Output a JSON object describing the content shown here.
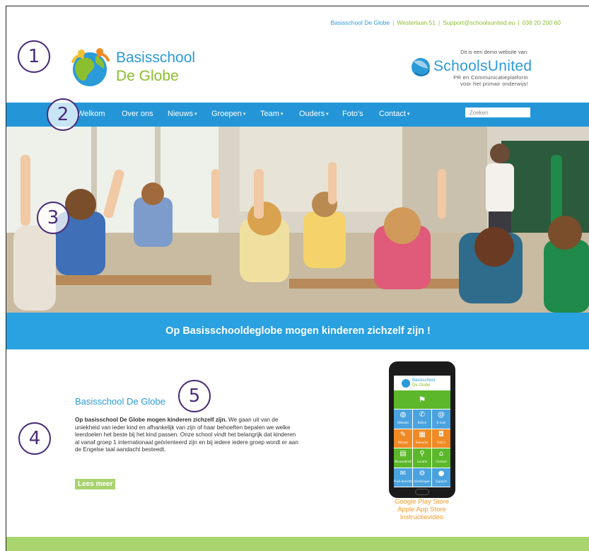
{
  "header": {
    "contact": {
      "school": "Basisschool De Globe",
      "address": "Westerlaan 51",
      "email": "Support@schoolsunited.eu",
      "phone": "038 20 200 60"
    },
    "logo": {
      "line1": "Basisschool",
      "line2": "De Globe"
    },
    "partner": {
      "note": "Dit is een demo website van:",
      "name": "SchoolsUnited",
      "tagline_1": "PR en Communicatieplatform",
      "tagline_2": "voor het primair onderwijs!"
    }
  },
  "nav": {
    "items": [
      {
        "label": "Welkom",
        "dropdown": false
      },
      {
        "label": "Over ons",
        "dropdown": false
      },
      {
        "label": "Nieuws",
        "dropdown": true
      },
      {
        "label": "Groepen",
        "dropdown": true
      },
      {
        "label": "Team",
        "dropdown": true
      },
      {
        "label": "Ouders",
        "dropdown": true
      },
      {
        "label": "Foto's",
        "dropdown": false
      },
      {
        "label": "Contact",
        "dropdown": true
      }
    ],
    "search_placeholder": "Zoeken"
  },
  "banner": {
    "text": "Op Basisschooldeglobe mogen kinderen zichzelf zijn !"
  },
  "content": {
    "heading": "Basisschool De Globe",
    "intro_bold": "Op basisschool De Globe mogen kinderen zichzelf zijn.",
    "intro_rest": " We gaan uit van de uniekheid van ieder kind en afhankelijk van zijn of haar behoeften bepalen we welke leerdoelen het beste bij het kind passen. Onze school vindt het belangrijk dat kinderen al vanaf groep 1 internationaal geörienteerd zijn en bij iedere iedere groep wordt er aan de Engelse taal aandacht besteedt.",
    "more_label": "Lees meer"
  },
  "app": {
    "screen_title_1": "Basisschool",
    "screen_title_2": "De Globe",
    "tiles": [
      {
        "label": "Website",
        "icon": "globe-icon",
        "color": "#4aa3df"
      },
      {
        "label": "Bellen",
        "icon": "phone-icon",
        "color": "#4aa3df"
      },
      {
        "label": "E-mail",
        "icon": "at-icon",
        "color": "#4aa3df"
      },
      {
        "label": "Nieuws",
        "icon": "pin-icon",
        "color": "#f08a24"
      },
      {
        "label": "Kalender",
        "icon": "calendar-icon",
        "color": "#f08a24"
      },
      {
        "label": "Foto's",
        "icon": "camera-icon",
        "color": "#f08a24"
      },
      {
        "label": "Nieuwsbrief",
        "icon": "document-icon",
        "color": "#5cb82a"
      },
      {
        "label": "Locatie",
        "icon": "location-icon",
        "color": "#5cb82a"
      },
      {
        "label": "Contact",
        "icon": "home-icon",
        "color": "#5cb82a"
      },
      {
        "label": "Push berichten",
        "icon": "envelope-icon",
        "color": "#4aa3df"
      },
      {
        "label": "Instellingen",
        "icon": "settings-icon",
        "color": "#4aa3df"
      },
      {
        "label": "Support",
        "icon": "support-icon",
        "color": "#4aa3df"
      }
    ],
    "links": [
      "Google Play Store",
      "Apple App Store",
      "Instructievideo"
    ]
  },
  "annotations": [
    "1",
    "2",
    "3",
    "4",
    "5"
  ],
  "colors": {
    "primary": "#2496d8",
    "accent_green": "#8bbf2f",
    "orange": "#f39a2b",
    "footer": "#aad46e",
    "annotation": "#4a2c79"
  }
}
